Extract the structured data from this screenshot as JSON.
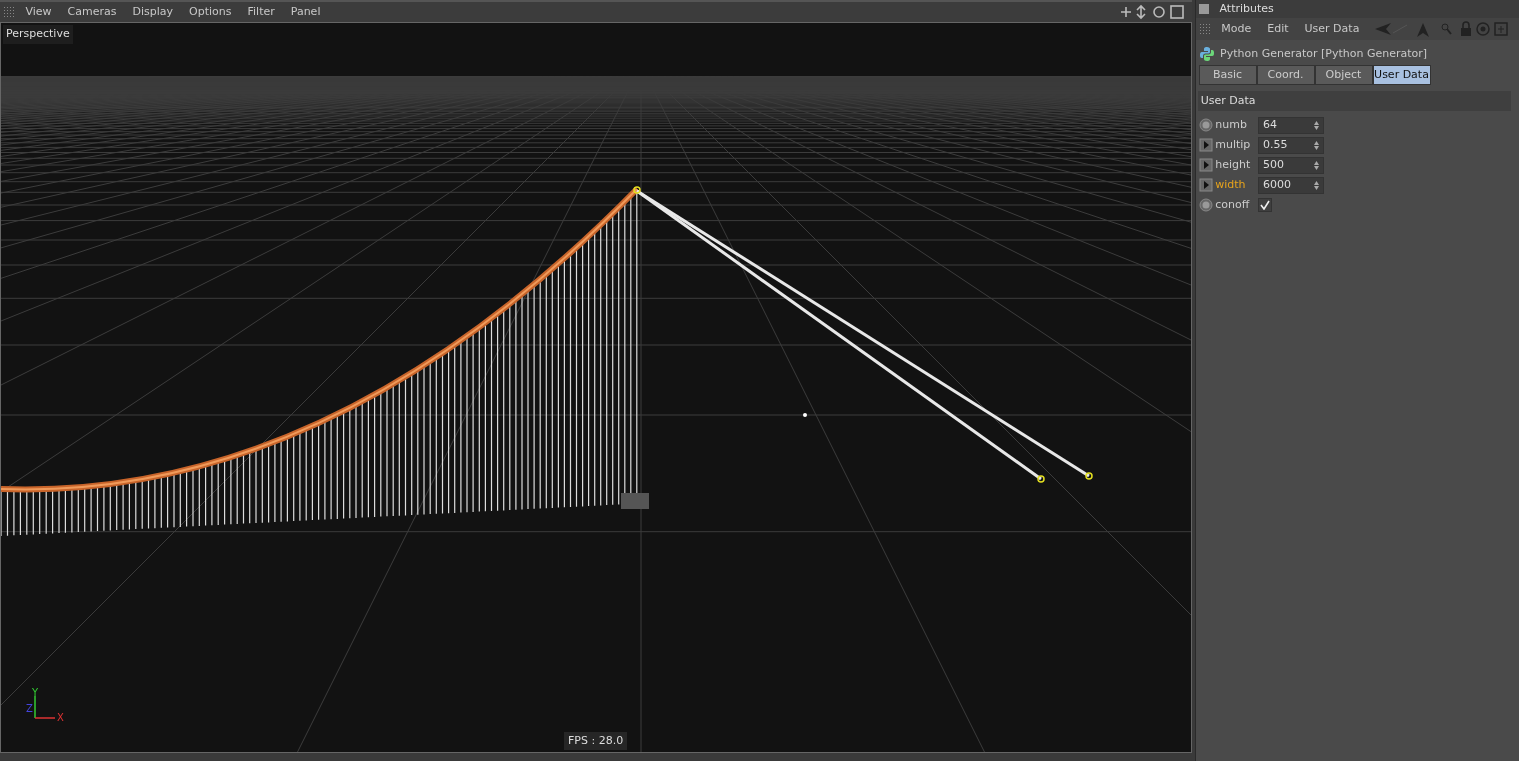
{
  "viewport": {
    "menu": [
      "View",
      "Cameras",
      "Display",
      "Options",
      "Filter",
      "Panel"
    ],
    "camera_label": "Perspective",
    "axis_labels": {
      "x": "X",
      "y": "Y",
      "z": "Z"
    },
    "fps": "FPS : 28.0"
  },
  "attributes": {
    "title": "Attributes",
    "menu": [
      "Mode",
      "Edit",
      "User Data"
    ],
    "object_name": "Python Generator [Python Generator]",
    "tabs": [
      {
        "label": "Basic",
        "selected": false
      },
      {
        "label": "Coord.",
        "selected": false
      },
      {
        "label": "Object",
        "selected": false
      },
      {
        "label": "User Data",
        "selected": true
      }
    ],
    "section": "User Data",
    "params": [
      {
        "kind": "number",
        "animated": false,
        "label": "numb",
        "value": "64",
        "highlighted": false
      },
      {
        "kind": "number",
        "animated": true,
        "label": "multip",
        "value": "0.55",
        "highlighted": false
      },
      {
        "kind": "number",
        "animated": true,
        "label": "height",
        "value": "500",
        "highlighted": false
      },
      {
        "kind": "number",
        "animated": true,
        "label": "width",
        "value": "6000",
        "highlighted": true
      },
      {
        "kind": "checkbox",
        "animated": false,
        "label": "conoff",
        "checked": true,
        "highlighted": false
      }
    ]
  }
}
